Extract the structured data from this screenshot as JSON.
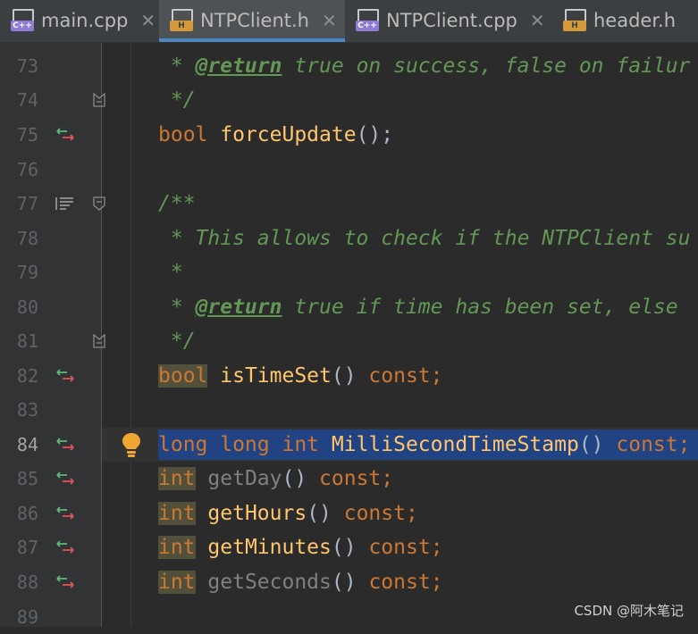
{
  "tabs": [
    {
      "label": "main.cpp",
      "icon": "cpp-file-icon",
      "active": false
    },
    {
      "label": "NTPClient.h",
      "icon": "header-file-icon",
      "active": true
    },
    {
      "label": "NTPClient.cpp",
      "icon": "cpp-file-icon",
      "active": false
    },
    {
      "label": "header.h",
      "icon": "header-file-icon",
      "active": false
    }
  ],
  "lines": [
    {
      "num": "73"
    },
    {
      "num": "74"
    },
    {
      "num": "75"
    },
    {
      "num": "76"
    },
    {
      "num": "77"
    },
    {
      "num": "78"
    },
    {
      "num": "79"
    },
    {
      "num": "80"
    },
    {
      "num": "81"
    },
    {
      "num": "82"
    },
    {
      "num": "83"
    },
    {
      "num": "84"
    },
    {
      "num": "85"
    },
    {
      "num": "86"
    },
    {
      "num": "87"
    },
    {
      "num": "88"
    },
    {
      "num": "89"
    }
  ],
  "code": {
    "l73": {
      "a": " * ",
      "tag": "@return",
      "b": " true on success, false on failur"
    },
    "l74": " */",
    "l75": {
      "kw": "bool",
      "fn": "forceUpdate",
      "rest": "();"
    },
    "l77": "/**",
    "l78": " * This allows to check if the NTPClient su",
    "l79": " *",
    "l80": {
      "a": " * ",
      "tag": "@return",
      "b": " true if time has been set, else "
    },
    "l81": " */",
    "l82": {
      "kw": "bool",
      "fn": "isTimeSet",
      "rest": "() ",
      "kw2": "const",
      "end": ";"
    },
    "l84": {
      "kw": "long long int",
      "fn": "MilliSecondTimeStamp",
      "rest": "() ",
      "kw2": "const",
      "end": ";"
    },
    "l85": {
      "kw": "int",
      "fn": "getDay",
      "rest": "() ",
      "kw2": "const",
      "end": ";"
    },
    "l86": {
      "kw": "int",
      "fn": "getHours",
      "rest": "() ",
      "kw2": "const",
      "end": ";"
    },
    "l87": {
      "kw": "int",
      "fn": "getMinutes",
      "rest": "() ",
      "kw2": "const",
      "end": ";"
    },
    "l88": {
      "kw": "int",
      "fn": "getSeconds",
      "rest": "() ",
      "kw2": "const",
      "end": ";"
    }
  },
  "watermark": "CSDN @阿木笔记",
  "colors": {
    "background": "#2b2b2b",
    "keyword": "#cc7832",
    "function": "#ffc66d",
    "comment": "#629755",
    "selection": "#214283"
  }
}
